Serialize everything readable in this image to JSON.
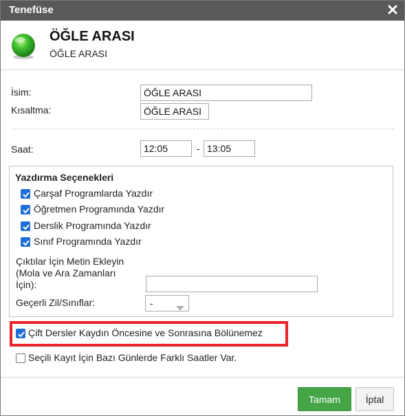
{
  "window": {
    "title": "Tenefüse"
  },
  "header": {
    "title": "ÖĞLE ARASI",
    "subtitle": "ÖĞLE ARASI"
  },
  "form": {
    "name_label": "İsim:",
    "name_value": "ÖĞLE ARASI",
    "short_label": "Kısaltma:",
    "short_value": "ÖĞLE ARASI",
    "time_label": "Saat:",
    "time_start": "12:05",
    "time_separator": "-",
    "time_end": "13:05"
  },
  "print_options": {
    "title": "Yazdırma Seçenekleri",
    "items": [
      {
        "label": "Çarşaf Programlarda Yazdır",
        "checked": true
      },
      {
        "label": "Öğretmen Programında Yazdır",
        "checked": true
      },
      {
        "label": "Derslik Programında Yazdır",
        "checked": true
      },
      {
        "label": "Sınıf Programında Yazdır",
        "checked": true
      }
    ],
    "output_text_label_line1": "Çıktılar İçin Metin Ekleyin",
    "output_text_label_line2": "(Mola ve Ara Zamanları",
    "output_text_label_line3": "İçin):",
    "output_text_value": "",
    "valid_bells_label": "Geçerli Zil/Sınıflar:",
    "valid_bells_value": "-"
  },
  "options": {
    "double_lessons": {
      "label": "Çift Dersler Kaydın Öncesine ve Sonrasına Bölünemez",
      "checked": true
    },
    "different_hours": {
      "label": "Seçili Kayıt İçin Bazı Günlerde Farklı Saatler Var.",
      "checked": false
    }
  },
  "footer": {
    "ok_label": "Tamam",
    "cancel_label": "İptal"
  },
  "colors": {
    "titlebar": "#595959",
    "accent_checkbox": "#1e6fd8",
    "ok_button": "#46a546",
    "highlight": "#e8232a",
    "status_ball": "#3fbf2f"
  }
}
